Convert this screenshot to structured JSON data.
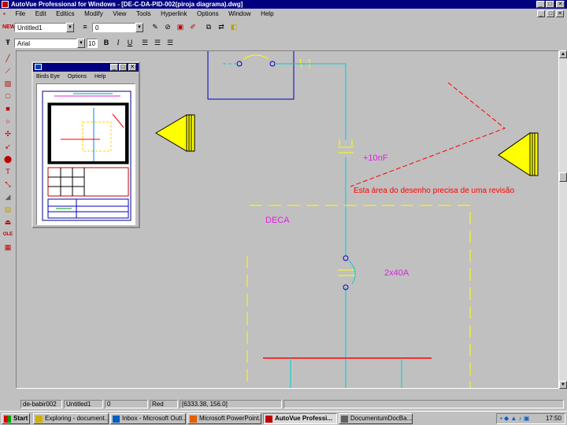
{
  "window": {
    "title": "AutoVue Professional for Windows - [DE-C-DA-PID-002(piroja diagrama).dwg]",
    "caption_buttons": [
      "_",
      "□",
      "✕"
    ],
    "mdi_buttons": [
      "_",
      "□",
      "✕"
    ]
  },
  "menu": [
    "File",
    "Edit",
    "Editics",
    "Modify",
    "View",
    "Tools",
    "Hyperlink",
    "Options",
    "Window",
    "Help"
  ],
  "toolbar1": {
    "layer_combo": "Untitled1",
    "linetype_combo": "0",
    "new_label": "NEW"
  },
  "toolbar2": {
    "font_combo": "Arial",
    "size_combo": "10",
    "bold": "B",
    "italic": "I",
    "underline": "U"
  },
  "birdseye": {
    "menu": [
      "Birds Eye",
      "Options",
      "Help"
    ]
  },
  "drawing": {
    "capacitor1_label": "+10nF",
    "capacitor2_label": "2x40A",
    "area_label": "DECA",
    "markup_note": "Esta área do desenho precisa de uma revisão",
    "colors": {
      "cyan": "#00d0d0",
      "yellow": "#ffff00",
      "magenta": "#e020e0",
      "red": "#ff0000",
      "blue": "#0000c0"
    }
  },
  "status": {
    "file": "de-babir002",
    "layer": "Untitled1",
    "value": "0",
    "color": "Red",
    "coords": "[6333.38, 156.0]"
  },
  "taskbar": {
    "start": "Start",
    "tasks": [
      "Exploring - document...",
      "Inbox - Microsoft Outl...",
      "Microsoft PowerPoint...",
      "AutoVue Professi...",
      "DocumentumDocBa..."
    ],
    "clock": "17:50"
  }
}
